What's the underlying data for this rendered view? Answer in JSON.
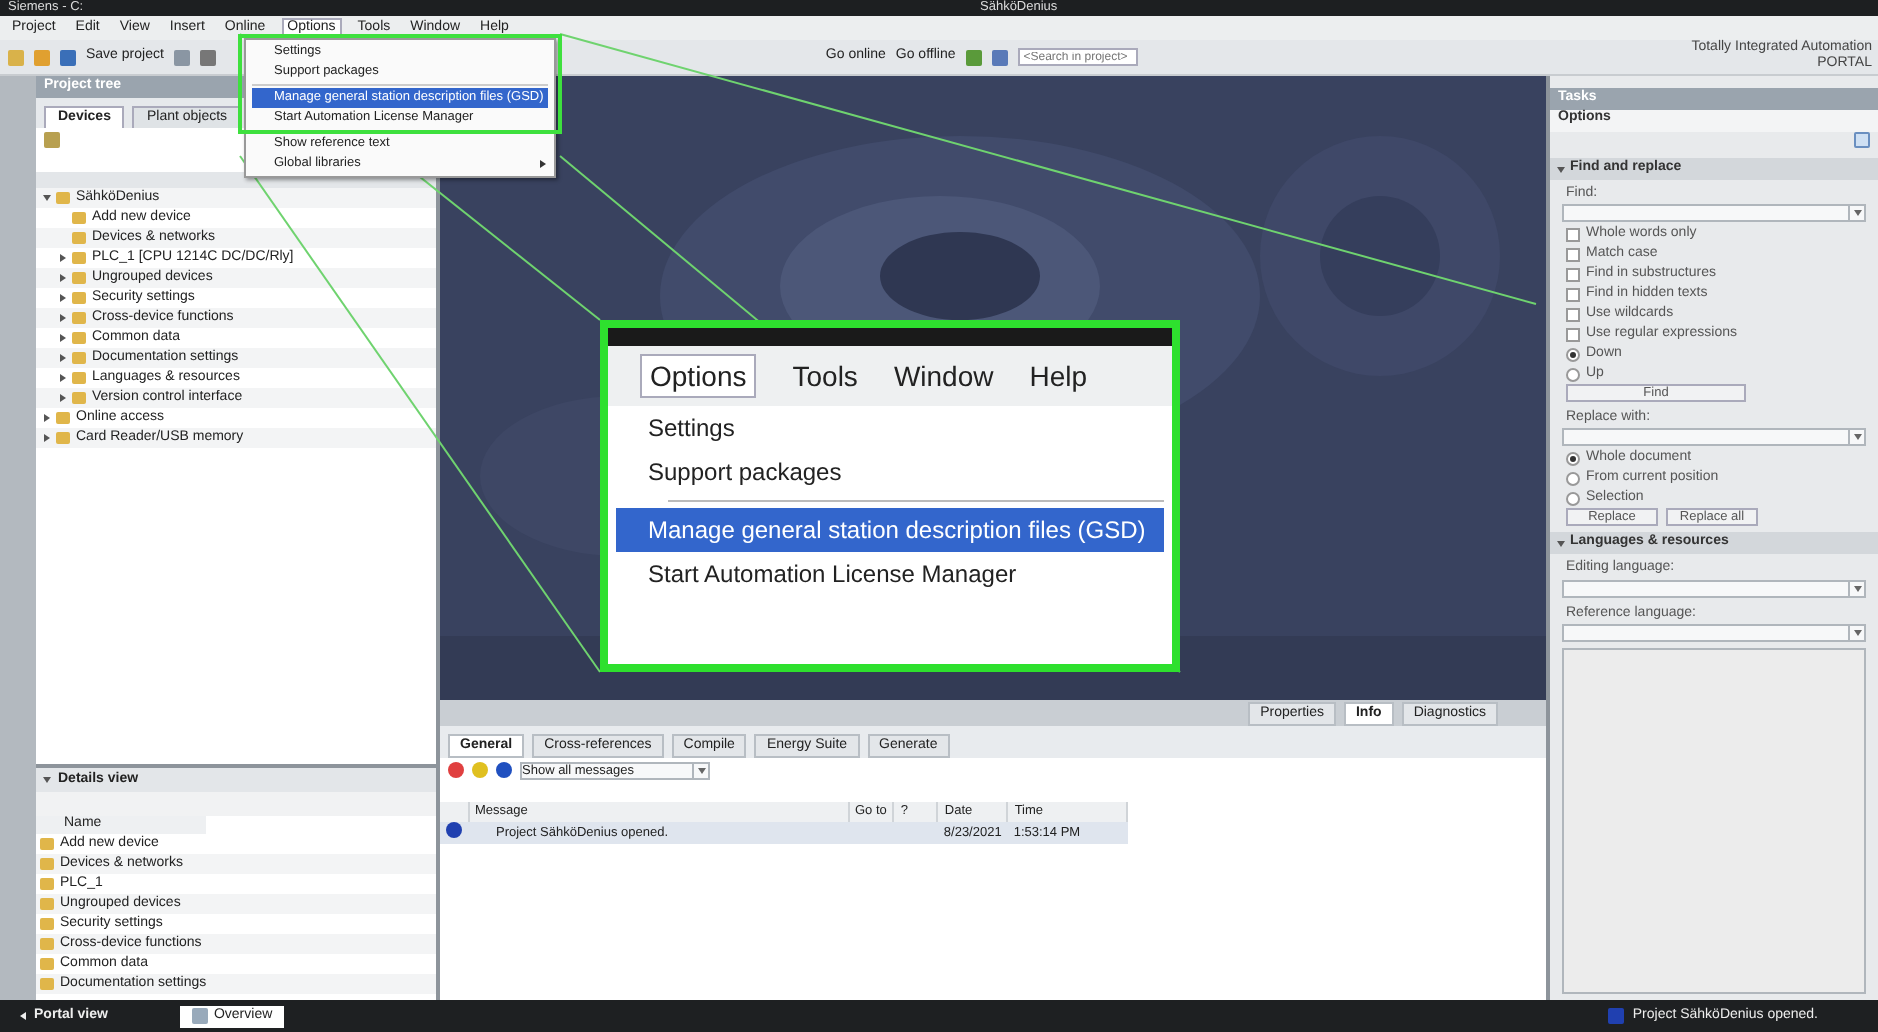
{
  "window": {
    "title": "Siemens - C:",
    "project_title": "SähköDenius"
  },
  "menu": [
    {
      "label": "Project",
      "selected": false
    },
    {
      "label": "Edit",
      "selected": false
    },
    {
      "label": "View",
      "selected": false
    },
    {
      "label": "Insert",
      "selected": false
    },
    {
      "label": "Online",
      "selected": false
    },
    {
      "label": "Options",
      "selected": true
    },
    {
      "label": "Tools",
      "selected": false
    },
    {
      "label": "Window",
      "selected": false
    },
    {
      "label": "Help",
      "selected": false
    }
  ],
  "toolbar": {
    "save_label": "Save project",
    "online_label": "Go online",
    "offline_label": "Go offline",
    "search_placeholder": "<Search in project>"
  },
  "brand": {
    "line1": "Totally Integrated Automation",
    "line2": "PORTAL"
  },
  "options_menu": [
    {
      "kind": "item",
      "label": "Settings",
      "selected": false
    },
    {
      "kind": "item",
      "label": "Support packages",
      "selected": false
    },
    {
      "kind": "separator"
    },
    {
      "kind": "item",
      "label": "Manage general station description files (GSD)",
      "selected": true
    },
    {
      "kind": "item",
      "label": "Start Automation License Manager",
      "selected": false
    },
    {
      "kind": "separator"
    },
    {
      "kind": "item",
      "label": "Show reference text",
      "selected": false
    },
    {
      "kind": "submenu",
      "label": "Global libraries",
      "selected": false
    }
  ],
  "callout": {
    "menu": [
      {
        "label": "Options",
        "selected": true
      },
      {
        "label": "Tools",
        "selected": false
      },
      {
        "label": "Window",
        "selected": false
      },
      {
        "label": "Help",
        "selected": false
      }
    ],
    "items": [
      {
        "kind": "item",
        "label": "Settings",
        "selected": false
      },
      {
        "kind": "item",
        "label": "Support packages",
        "selected": false
      },
      {
        "kind": "separator"
      },
      {
        "kind": "item",
        "label": "Manage general station description files (GSD)",
        "selected": true
      },
      {
        "kind": "item",
        "label": "Start Automation License Manager",
        "selected": false
      }
    ]
  },
  "project_tree": {
    "title": "Project tree",
    "tabs": [
      {
        "label": "Devices",
        "selected": true
      },
      {
        "label": "Plant objects",
        "selected": false
      }
    ],
    "items": [
      {
        "label": "SähköDenius",
        "expanded": true,
        "children": [
          {
            "label": "Add new device"
          },
          {
            "label": "Devices & networks"
          },
          {
            "label": "PLC_1 [CPU 1214C DC/DC/Rly]",
            "expanded": false
          },
          {
            "label": "Ungrouped devices",
            "expanded": false
          },
          {
            "label": "Security settings",
            "expanded": false
          },
          {
            "label": "Cross-device functions",
            "expanded": false
          },
          {
            "label": "Common data",
            "expanded": false
          },
          {
            "label": "Documentation settings",
            "expanded": false
          },
          {
            "label": "Languages & resources",
            "expanded": false
          },
          {
            "label": "Version control interface",
            "expanded": false
          }
        ]
      },
      {
        "label": "Online access",
        "expanded": false
      },
      {
        "label": "Card Reader/USB memory",
        "expanded": false
      }
    ]
  },
  "details_view": {
    "title": "Details view",
    "column": "Name",
    "items": [
      "Add new device",
      "Devices & networks",
      "PLC_1",
      "Ungrouped devices",
      "Security settings",
      "Cross-device functions",
      "Common data",
      "Documentation settings"
    ]
  },
  "inspector": {
    "tabs": [
      {
        "label": "Properties",
        "selected": false
      },
      {
        "label": "Info",
        "selected": true
      },
      {
        "label": "Diagnostics",
        "selected": false
      }
    ],
    "subtabs": [
      {
        "label": "General",
        "selected": true
      },
      {
        "label": "Cross-references",
        "selected": false
      },
      {
        "label": "Compile",
        "selected": false
      },
      {
        "label": "Energy Suite",
        "selected": false
      },
      {
        "label": "Generate",
        "selected": false
      }
    ],
    "filter": "Show all messages",
    "columns": [
      "Message",
      "Go to",
      "?",
      "Date",
      "Time"
    ],
    "rows": [
      {
        "cells": [
          "Project SähköDenius opened.",
          "",
          "",
          "8/23/2021",
          "1:53:14 PM"
        ]
      }
    ]
  },
  "task_card": {
    "title": "Tasks",
    "options_label": "Options",
    "find_section": {
      "title": "Find and replace",
      "expanded": true,
      "find_label": "Find:",
      "checks": [
        {
          "label": "Whole words only",
          "checked": false
        },
        {
          "label": "Match case",
          "checked": false
        },
        {
          "label": "Find in substructures",
          "checked": false
        },
        {
          "label": "Find in hidden texts",
          "checked": false
        },
        {
          "label": "Use wildcards",
          "checked": false
        },
        {
          "label": "Use regular expressions",
          "checked": false
        }
      ],
      "direction": [
        {
          "label": "Down",
          "selected": true
        },
        {
          "label": "Up",
          "selected": false
        }
      ],
      "find_button": "Find",
      "replace_label": "Replace with:",
      "scope": [
        {
          "label": "Whole document",
          "selected": true
        },
        {
          "label": "From current position",
          "selected": false
        },
        {
          "label": "Selection",
          "selected": false
        }
      ],
      "buttons": [
        "Replace",
        "Replace all"
      ]
    },
    "languages_section": {
      "title": "Languages & resources",
      "expanded": true,
      "editing_label": "Editing language:",
      "reference_label": "Reference language:"
    }
  },
  "status_bar": {
    "portal_view": "Portal view",
    "overview": "Overview",
    "message": "Project SähköDenius opened."
  }
}
